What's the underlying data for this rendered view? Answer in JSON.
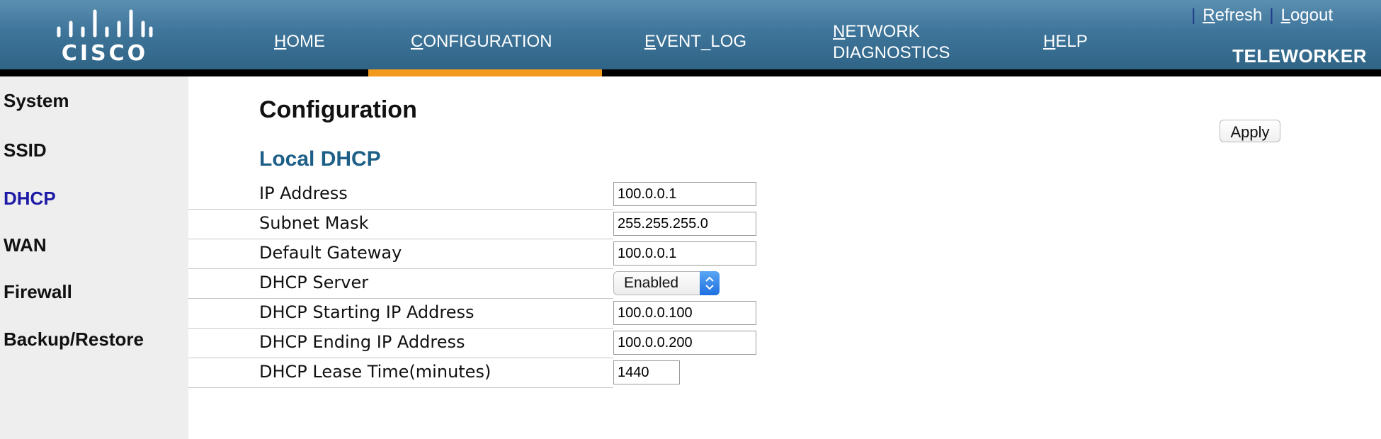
{
  "header": {
    "logo_text": "CISCO",
    "nav": [
      {
        "access": "H",
        "rest": "OME"
      },
      {
        "access": "C",
        "rest": "ONFIGURATION"
      },
      {
        "access": "E",
        "rest": "VENT_LOG"
      },
      {
        "access": "N",
        "rest": "ETWORK",
        "line2": "DIAGNOSTICS"
      },
      {
        "access": "H",
        "rest": "ELP"
      }
    ],
    "active_nav": "CONFIGURATION",
    "refresh": {
      "access": "R",
      "rest": "efresh"
    },
    "logout": {
      "access": "L",
      "rest": "ogout"
    },
    "separator": "|",
    "product": "TELEWORKER"
  },
  "sidebar": {
    "items": [
      "System",
      "SSID",
      "DHCP",
      "WAN",
      "Firewall",
      "Backup/Restore"
    ],
    "active": "DHCP"
  },
  "main": {
    "title": "Configuration",
    "apply_label": "Apply",
    "section_title": "Local DHCP",
    "rows": [
      {
        "label": "IP Address",
        "value": "100.0.0.1",
        "type": "input"
      },
      {
        "label": "Subnet Mask",
        "value": "255.255.255.0",
        "type": "input"
      },
      {
        "label": "Default Gateway",
        "value": "100.0.0.1",
        "type": "input"
      },
      {
        "label": "DHCP Server",
        "value": "Enabled",
        "type": "select"
      },
      {
        "label": "DHCP Starting IP Address",
        "value": "100.0.0.100",
        "type": "input"
      },
      {
        "label": "DHCP Ending IP Address",
        "value": "100.0.0.200",
        "type": "input"
      },
      {
        "label": "DHCP Lease Time(minutes)",
        "value": "1440",
        "type": "input-short"
      }
    ]
  },
  "colors": {
    "header_top": "#5b8fb2",
    "header_bottom": "#2f6486",
    "active_tab": "#f39a1c",
    "section_title": "#1d5f87",
    "sidebar_active": "#1d1aa6",
    "sidebar_bg": "#eeeeee"
  }
}
